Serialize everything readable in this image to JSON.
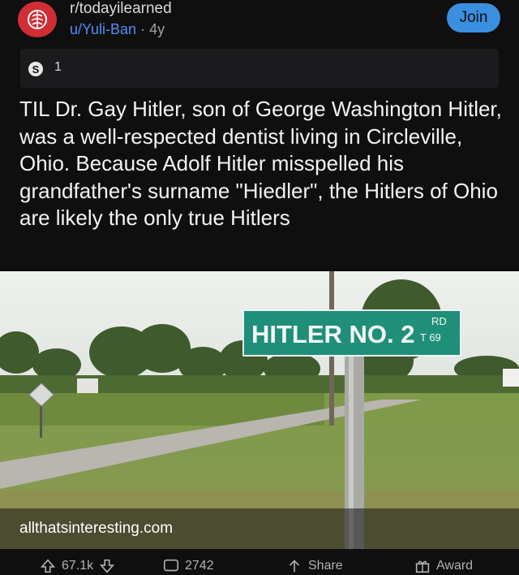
{
  "header": {
    "subreddit": "r/todayilearned",
    "user": "u/Yuli-Ban",
    "separator": " · ",
    "age": "4y",
    "join_label": "Join"
  },
  "awards": {
    "count": "1"
  },
  "post": {
    "title": "TIL Dr. Gay Hitler, son of George Washington Hitler, was a well-respected dentist living in Circleville, Ohio. Because Adolf Hitler misspelled his grandfather's surname \"Hiedler\", the Hitlers of Ohio are likely the only true Hitlers"
  },
  "image": {
    "sign_main": "HITLER NO. 2",
    "sign_rd": "RD",
    "sign_num": "T 69"
  },
  "link": {
    "domain": "allthatsinteresting.com"
  },
  "actions": {
    "upvotes": "67.1k",
    "comments": "2742",
    "share": "Share",
    "award": "Award"
  }
}
